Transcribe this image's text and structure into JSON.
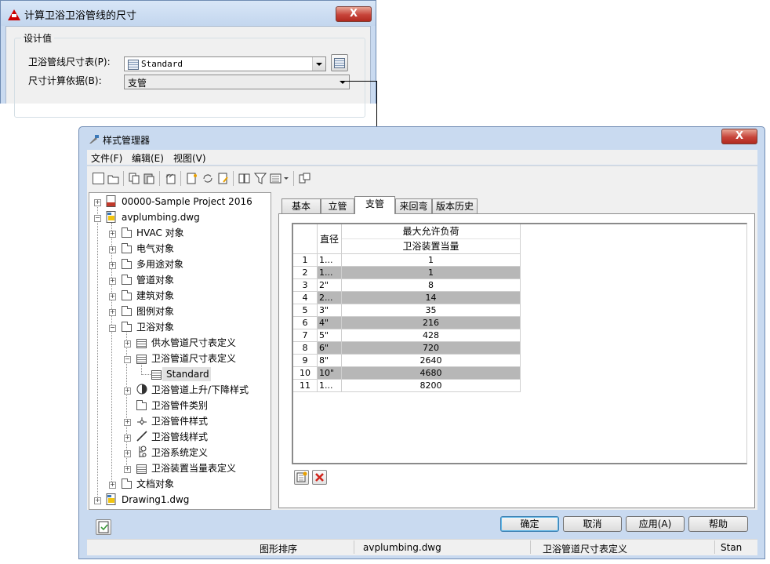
{
  "dialog1": {
    "title": "计算卫浴卫浴管线的尺寸",
    "close": "X",
    "group_label": "设计值",
    "table_label": "卫浴管线尺寸表(P):",
    "table_value": "Standard",
    "basis_label": "尺寸计算依据(B):",
    "basis_value": "支管"
  },
  "dialog2": {
    "title": "样式管理器",
    "close": "X",
    "menu": [
      "文件(F)",
      "编辑(E)",
      "视图(V)"
    ],
    "tree": {
      "project": "00000-Sample Project 2016",
      "drawing": "avplumbing.dwg",
      "folders": [
        "HVAC 对象",
        "电气对象",
        "多用途对象",
        "管道对象",
        "建筑对象",
        "图例对象",
        "卫浴对象"
      ],
      "sub": [
        "供水管道尺寸表定义",
        "卫浴管道尺寸表定义"
      ],
      "standard": "Standard",
      "sub2": [
        "卫浴管道上升/下降样式",
        "卫浴管件类别",
        "卫浴管件样式",
        "卫浴管线样式",
        "卫浴系统定义",
        "卫浴装置当量表定义"
      ],
      "docs": "文档对象",
      "drawing1": "Drawing1.dwg"
    },
    "tabs": [
      "基本",
      "立管",
      "支管",
      "来回弯",
      "版本历史"
    ],
    "active_tab": "支管",
    "grid": {
      "col_diameter": "直径",
      "col_load_top": "最大允许负荷",
      "col_load_bottom": "卫浴装置当量",
      "rows": [
        {
          "n": "1",
          "d": "1...",
          "v": "1"
        },
        {
          "n": "2",
          "d": "1...",
          "v": "1"
        },
        {
          "n": "3",
          "d": "2\"",
          "v": "8"
        },
        {
          "n": "4",
          "d": "2...",
          "v": "14"
        },
        {
          "n": "5",
          "d": "3\"",
          "v": "35"
        },
        {
          "n": "6",
          "d": "4\"",
          "v": "216"
        },
        {
          "n": "7",
          "d": "5\"",
          "v": "428"
        },
        {
          "n": "8",
          "d": "6\"",
          "v": "720"
        },
        {
          "n": "9",
          "d": "8\"",
          "v": "2640"
        },
        {
          "n": "10",
          "d": "10\"",
          "v": "4680"
        },
        {
          "n": "11",
          "d": "1...",
          "v": "8200"
        }
      ]
    },
    "buttons": {
      "ok": "确定",
      "cancel": "取消",
      "apply": "应用(A)",
      "help": "帮助"
    },
    "status": [
      "图形排序",
      "avplumbing.dwg",
      "卫浴管道尺寸表定义",
      "Stan"
    ]
  }
}
